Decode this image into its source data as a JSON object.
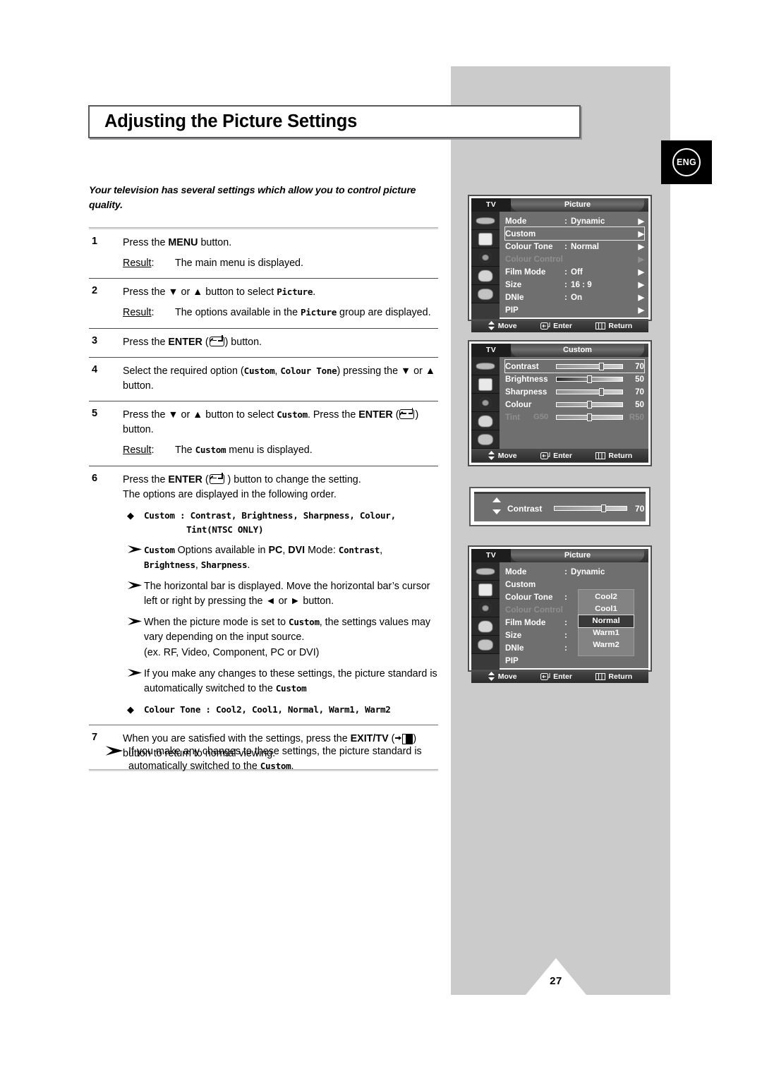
{
  "page": {
    "number": "27",
    "language_badge": "ENG"
  },
  "title": "Adjusting the Picture Settings",
  "intro": "Your television has several settings which allow you to control picture quality.",
  "steps": [
    {
      "num": "1",
      "text_a": "Press the ",
      "bold": "MENU",
      "text_b": " button.",
      "result_label": "Result",
      "result_text": "The main menu is displayed."
    },
    {
      "num": "2",
      "text_a": "Press the ▼ or ▲ button to select ",
      "mono": "Picture",
      "text_b": ".",
      "result_label": "Result",
      "result_a": "The options available in the ",
      "result_mono": "Picture",
      "result_b": " group are displayed."
    },
    {
      "num": "3",
      "text_a": "Press the ",
      "bold": "ENTER",
      "text_b": " (",
      "text_c": ") button."
    },
    {
      "num": "4",
      "text_a": "Select the required option (",
      "mono_a": "Custom",
      "text_b": ", ",
      "mono_b": "Colour Tone",
      "text_c": ") pressing the ▼ or ▲ button."
    },
    {
      "num": "5",
      "text_a": "Press the ▼ or ▲ button to select ",
      "mono_a": "Custom",
      "text_b": ". Press the ",
      "bold": "ENTER",
      "text_c": " (",
      "text_d": ") button.",
      "result_label": "Result",
      "result_a": "The ",
      "result_mono": "Custom",
      "result_b": " menu is displayed."
    },
    {
      "num": "6",
      "text_a": "Press the ",
      "bold": "ENTER",
      "text_b": " (",
      "text_c": " ) button to change the setting.",
      "text_d": "The options are displayed in the following order.",
      "bullets": [
        {
          "marker": "diamond",
          "mono_head": "Custom",
          "sep": " : ",
          "mono_body": "Contrast, Brightness, Sharpness, Colour,",
          "mono_body2": "Tint(NTSC ONLY)"
        },
        {
          "marker": "arrow",
          "mono_a": "Custom",
          "text_a": " Options available in ",
          "bold_a": "PC",
          "text_b": ", ",
          "bold_b": "DVI",
          "text_c": " Mode: ",
          "mono_b": "Contrast",
          "text_d": ", ",
          "mono_c": "Brightness",
          "text_e": ", ",
          "mono_d": "Sharpness",
          "text_f": "."
        },
        {
          "marker": "arrow",
          "text_plain": "The horizontal bar is displayed. Move the horizontal bar’s cursor left or right by pressing the ◄ or ► button."
        },
        {
          "marker": "arrow",
          "text_a": "When the picture mode is set to ",
          "mono_a": "Custom",
          "text_b": ", the settings values may vary depending on the input source.",
          "text_c": "(ex. RF, Video, Component, PC or DVI)"
        },
        {
          "marker": "arrow",
          "text_a": "If you make any changes to these settings, the picture standard is automatically switched to the ",
          "mono_a": "Custom"
        },
        {
          "marker": "diamond",
          "mono_head": "Colour Tone",
          "sep": " : ",
          "mono_body": "Cool2, Cool1, Normal, Warm1, Warm2"
        }
      ]
    },
    {
      "num": "7",
      "text_a": "When you are satisfied with the settings, press the ",
      "bold": "EXIT/TV",
      "text_b": " (",
      "text_c": ") button to return to normal viewing."
    }
  ],
  "final_note": {
    "marker": "arrow",
    "text_a": "If you make any changes to these settings, the picture standard is automatically switched to the ",
    "mono_a": "Custom",
    "text_b": "."
  },
  "osd": {
    "footer": {
      "move": "Move",
      "enter": "Enter",
      "return": "Return"
    },
    "picture_menu": {
      "source_label": "TV",
      "title": "Picture",
      "rows": [
        {
          "label": "Mode",
          "colon": ":",
          "value": "Dynamic",
          "arrow": "▶",
          "state": "normal"
        },
        {
          "label": "Custom",
          "colon": "",
          "value": "",
          "arrow": "▶",
          "state": "selected"
        },
        {
          "label": "Colour Tone",
          "colon": ":",
          "value": "Normal",
          "arrow": "▶",
          "state": "normal"
        },
        {
          "label": "Colour Control",
          "colon": "",
          "value": "",
          "arrow": "▶",
          "state": "dim"
        },
        {
          "label": "Film Mode",
          "colon": ":",
          "value": "Off",
          "arrow": "▶",
          "state": "normal"
        },
        {
          "label": "Size",
          "colon": ":",
          "value": "16 : 9",
          "arrow": "▶",
          "state": "normal"
        },
        {
          "label": "DNIe",
          "colon": ":",
          "value": "On",
          "arrow": "▶",
          "state": "normal"
        },
        {
          "label": "PIP",
          "colon": "",
          "value": "",
          "arrow": "▶",
          "state": "normal"
        }
      ]
    },
    "custom_menu": {
      "source_label": "TV",
      "title": "Custom",
      "rows": [
        {
          "label": "Contrast",
          "num": "70",
          "pos": 64,
          "state": "selected",
          "bar": "light"
        },
        {
          "label": "Brightness",
          "num": "50",
          "pos": 46,
          "state": "normal",
          "bar": "dark"
        },
        {
          "label": "Sharpness",
          "num": "70",
          "pos": 64,
          "state": "normal",
          "bar": "light"
        },
        {
          "label": "Colour",
          "num": "50",
          "pos": 46,
          "state": "normal",
          "bar": "light"
        },
        {
          "label": "Tint",
          "left_label": "G50",
          "num": "R50",
          "pos": 46,
          "state": "dim",
          "bar": "light"
        }
      ]
    },
    "contrast_bar": {
      "label": "Contrast",
      "value": "70",
      "pos": 64
    },
    "colour_tone_menu": {
      "source_label": "TV",
      "title": "Picture",
      "rows": [
        {
          "label": "Mode",
          "colon": ":",
          "value": "Dynamic",
          "state": "normal"
        },
        {
          "label": "Custom",
          "colon": "",
          "value": "",
          "state": "normal"
        },
        {
          "label": "Colour Tone",
          "colon": ":",
          "value": "",
          "state": "normal"
        },
        {
          "label": "Colour Control",
          "colon": "",
          "value": "",
          "state": "dim"
        },
        {
          "label": "Film Mode",
          "colon": ":",
          "value": "",
          "state": "normal"
        },
        {
          "label": "Size",
          "colon": ":",
          "value": "",
          "state": "normal"
        },
        {
          "label": "DNIe",
          "colon": ":",
          "value": "",
          "state": "normal"
        },
        {
          "label": "PIP",
          "colon": "",
          "value": "",
          "state": "normal"
        }
      ],
      "dropdown": [
        {
          "label": "Cool2",
          "selected": false
        },
        {
          "label": "Cool1",
          "selected": false
        },
        {
          "label": "Normal",
          "selected": true
        },
        {
          "label": "Warm1",
          "selected": false
        },
        {
          "label": "Warm2",
          "selected": false
        }
      ]
    }
  },
  "colors": {
    "band": "#cbcbcb",
    "osd_bg": "#6f6f6f",
    "osd_dim": "#8f8f8f"
  }
}
